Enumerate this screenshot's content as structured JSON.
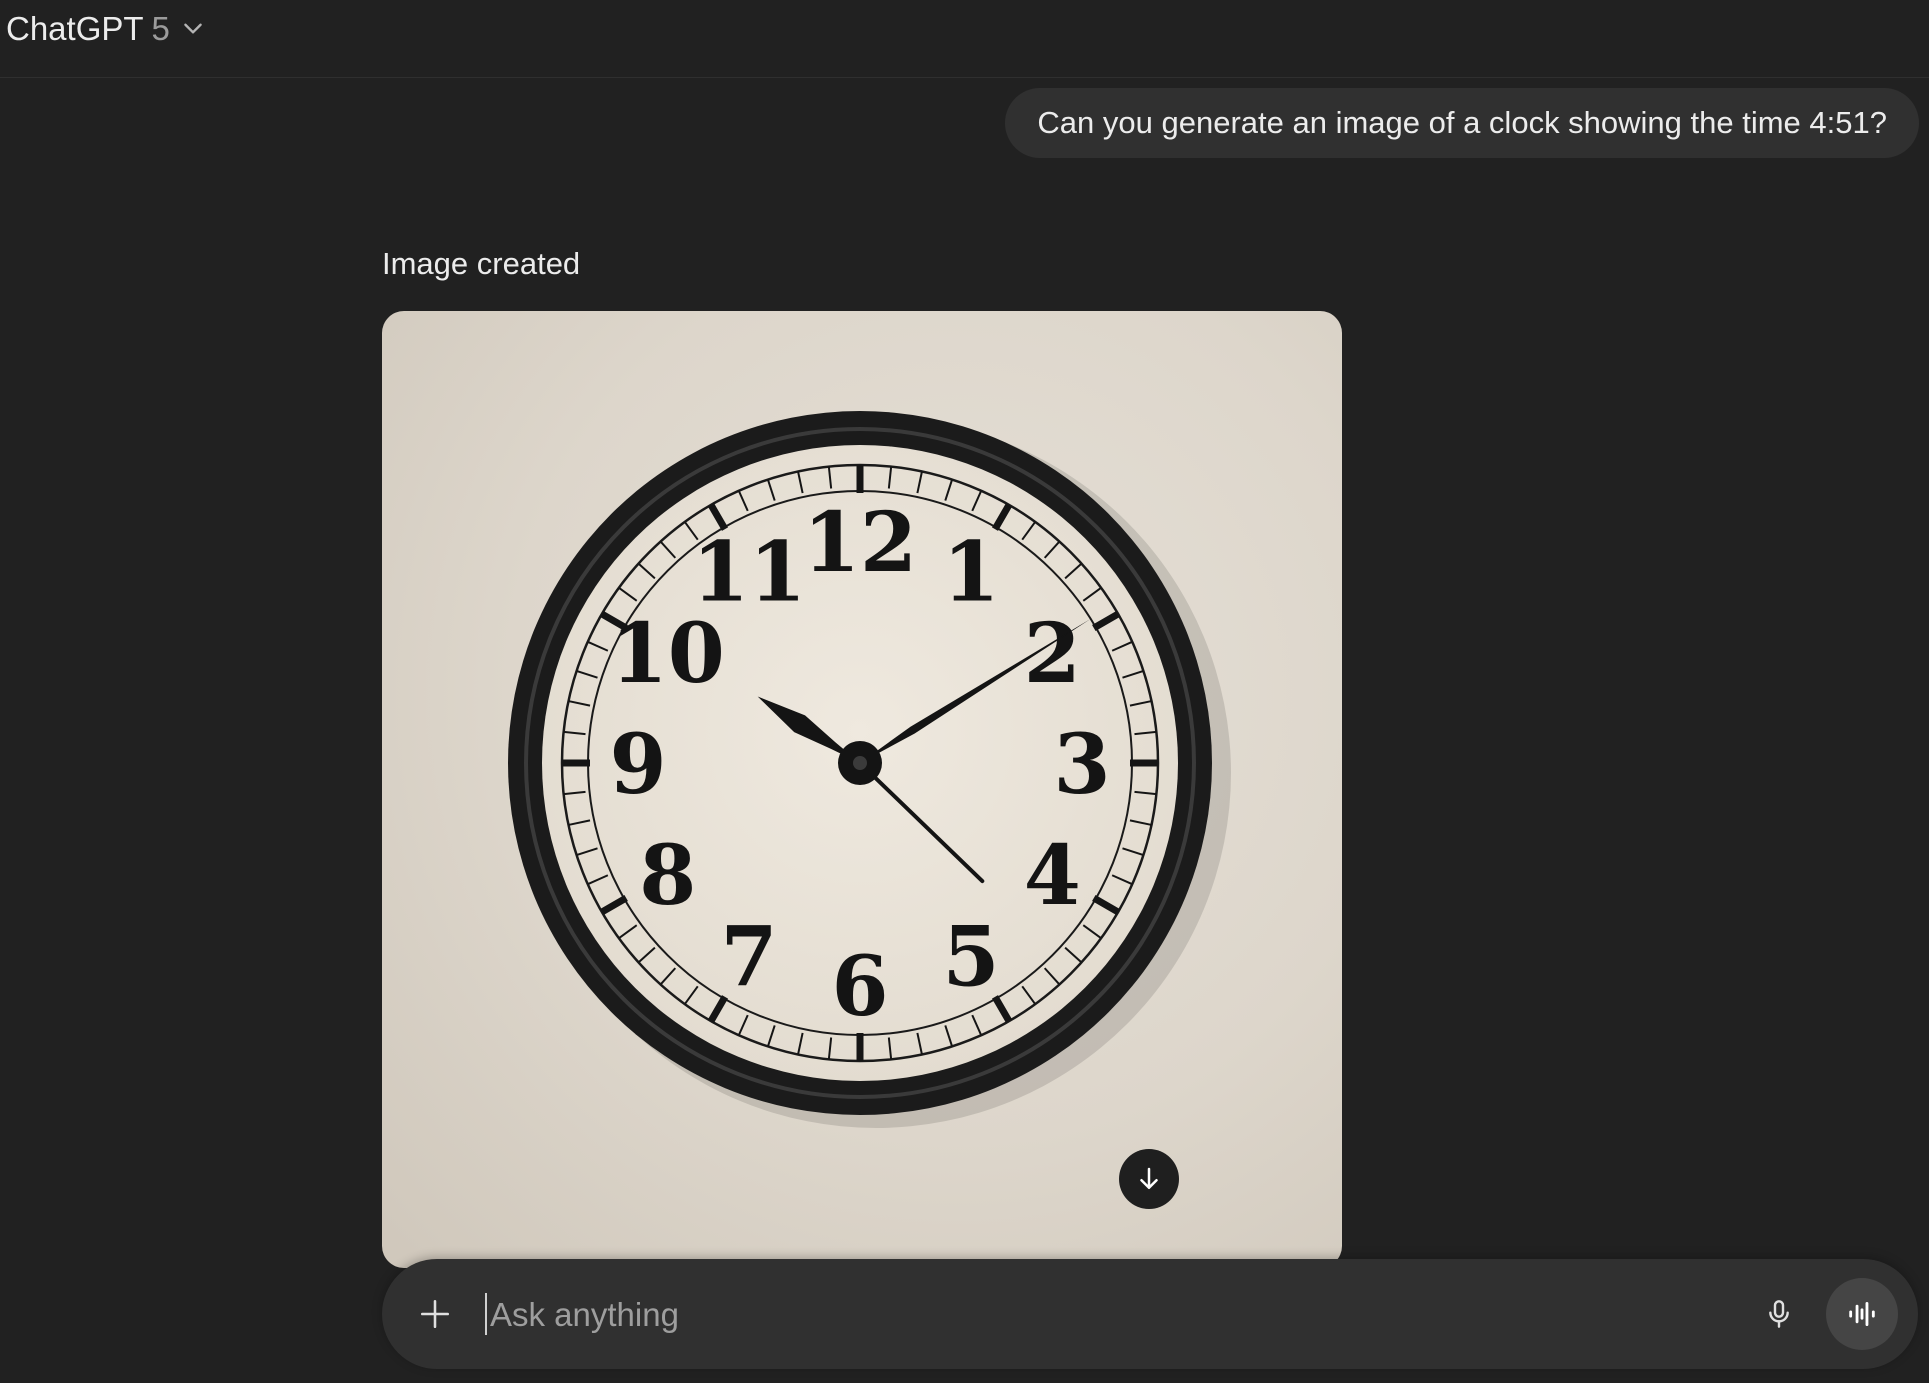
{
  "header": {
    "model_name": "ChatGPT",
    "model_version": "5",
    "switcher_icon": "chevron-down-icon"
  },
  "conversation": {
    "user_message": "Can you generate an image of a clock showing the time 4:51?",
    "assistant_status": "Image created",
    "image": {
      "clock_numerals": [
        "12",
        "1",
        "2",
        "3",
        "4",
        "5",
        "6",
        "7",
        "8",
        "9",
        "10",
        "11"
      ],
      "download_icon": "arrow-down-icon"
    }
  },
  "composer": {
    "placeholder": "Ask anything",
    "value": "",
    "plus_icon": "plus-icon",
    "mic_icon": "microphone-icon",
    "voice_icon": "voice-waveform-icon"
  },
  "colors": {
    "background": "#212121",
    "bubble": "#303030",
    "text": "#ececec",
    "muted": "#9b9b9b"
  }
}
